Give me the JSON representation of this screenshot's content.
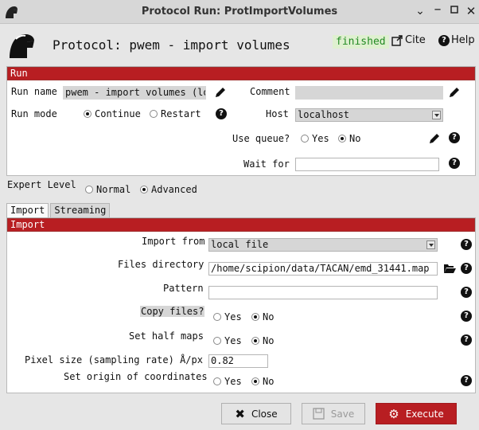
{
  "window": {
    "title": "Protocol Run: ProtImportVolumes"
  },
  "header": {
    "protocol_title": "Protocol: pwem - import volumes",
    "status": "finished",
    "cite_label": "Cite",
    "help_label": "Help"
  },
  "run": {
    "section_title": "Run",
    "run_name_label": "Run name",
    "run_name_value": "pwem - import volumes (loc",
    "comment_label": "Comment",
    "comment_value": "",
    "run_mode_label": "Run mode",
    "run_mode_options": [
      "Continue",
      "Restart"
    ],
    "run_mode_selected": "Continue",
    "host_label": "Host",
    "host_value": "localhost",
    "queue_label": "Use queue?",
    "queue_options": [
      "Yes",
      "No"
    ],
    "queue_selected": "No",
    "wait_label": "Wait for",
    "wait_value": ""
  },
  "expert": {
    "label": "Expert Level",
    "options": [
      "Normal",
      "Advanced"
    ],
    "selected": "Advanced"
  },
  "tabs": [
    "Import",
    "Streaming"
  ],
  "import": {
    "section_title": "Import",
    "import_from_label": "Import from",
    "import_from_value": "local file",
    "files_dir_label": "Files directory",
    "files_dir_value": "/home/scipion/data/TACAN/emd_31441.map",
    "pattern_label": "Pattern",
    "pattern_value": "",
    "copy_files_label": "Copy files?",
    "copy_files_selected": "No",
    "half_maps_label": "Set half maps",
    "half_maps_selected": "No",
    "pixel_size_label": "Pixel size (sampling rate) Å/px",
    "pixel_size_value": "0.82",
    "origin_label": "Set origin of coordinates",
    "origin_selected": "No",
    "yes": "Yes",
    "no": "No"
  },
  "footer": {
    "close_label": "Close",
    "save_label": "Save",
    "execute_label": "Execute"
  },
  "colors": {
    "accent": "#b81e22",
    "status_bg": "#dff0d0",
    "status_fg": "#238a23"
  }
}
